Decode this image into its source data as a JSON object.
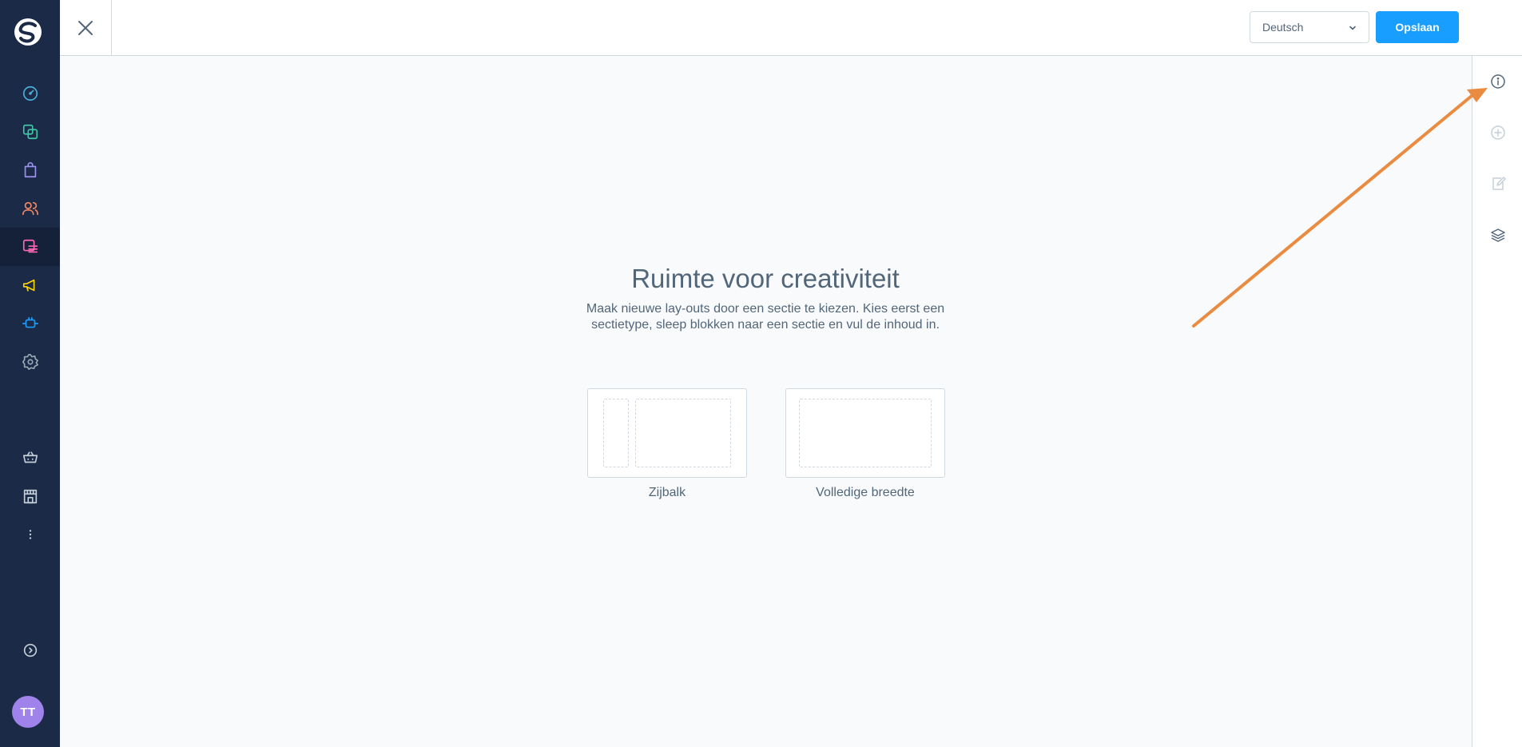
{
  "header": {
    "language": "Deutsch",
    "save_label": "Opslaan"
  },
  "user": {
    "initials": "TT"
  },
  "empty_state": {
    "title": "Ruimte voor creativiteit",
    "description": "Maak nieuwe lay-outs door een sectie te kiezen. Kies eerst een sectietype, sleep blokken naar een sectie en vul de inhoud in."
  },
  "section_types": [
    {
      "label": "Zijbalk"
    },
    {
      "label": "Volledige breedte"
    }
  ],
  "sidebar": {
    "icons": [
      "dashboard-icon",
      "catalogue-icon",
      "orders-icon",
      "customers-icon",
      "content-icon",
      "marketing-icon",
      "extensions-icon",
      "settings-icon",
      "sales-channel-icon",
      "storefront-icon",
      "more-icon",
      "collapse-icon"
    ]
  },
  "side_panel": {
    "icons": [
      "info-icon",
      "add-block-icon",
      "edit-icon",
      "layers-icon"
    ]
  },
  "colors": {
    "sidebar_bg": "#1b2a47",
    "primary": "#189eff",
    "annotation_arrow": "#e98b41",
    "text": "#52667a"
  }
}
